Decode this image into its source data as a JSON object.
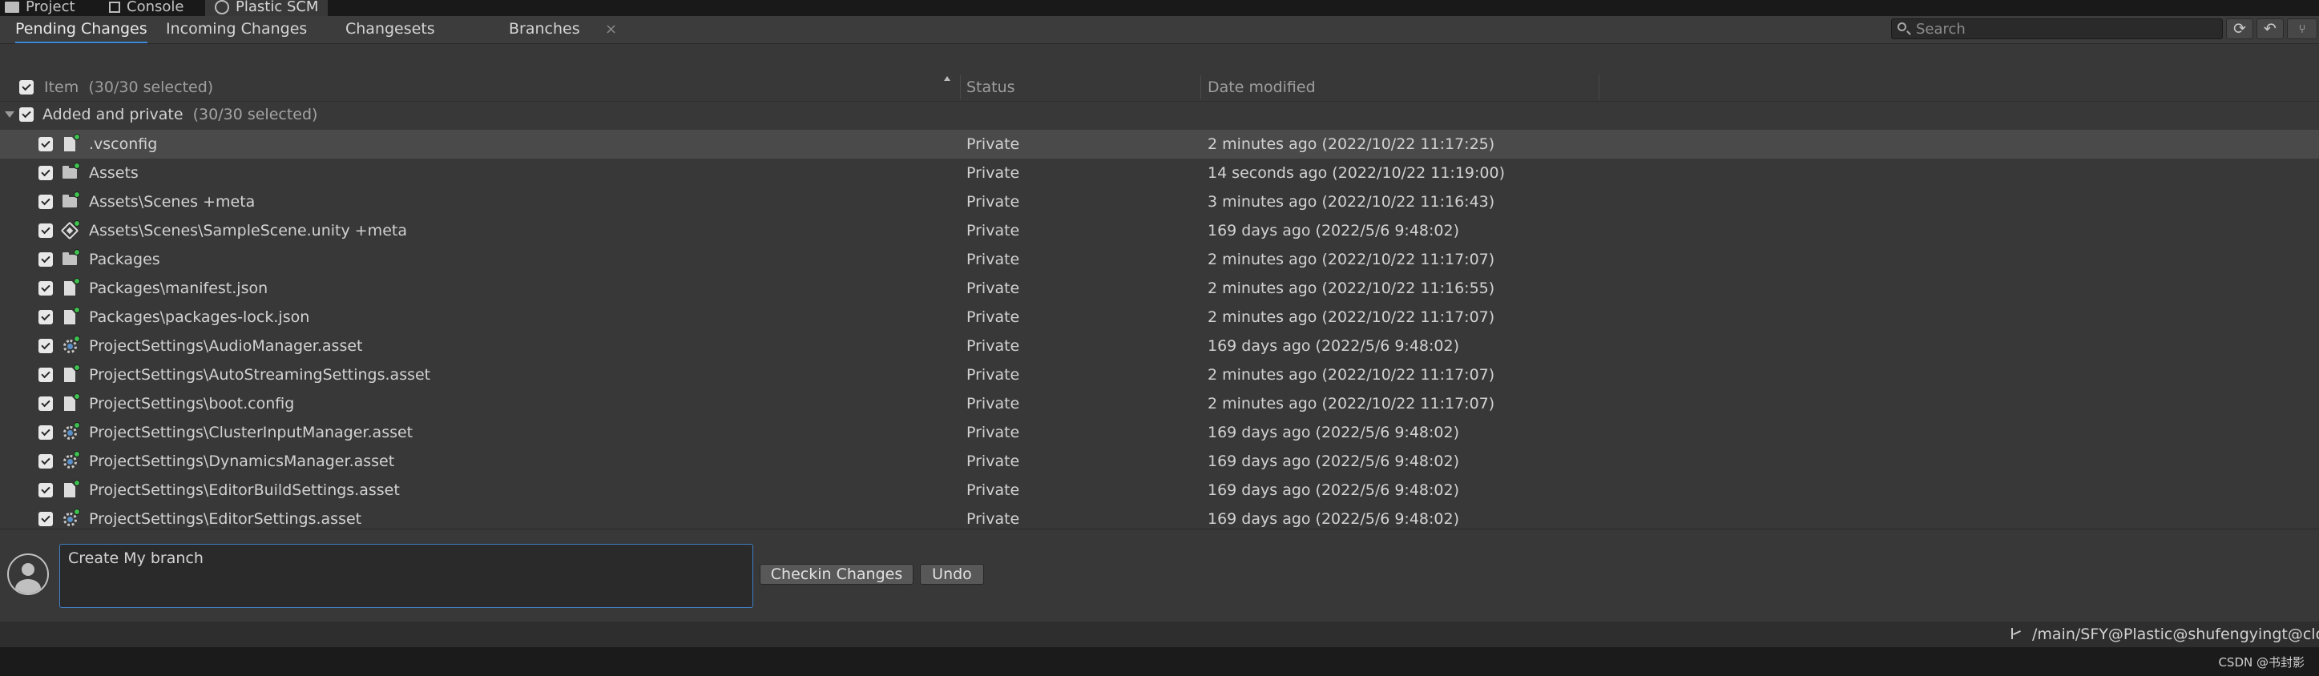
{
  "window_tabs": [
    {
      "label": "Project",
      "icon": "folder-icon"
    },
    {
      "label": "Console",
      "icon": "console-icon"
    },
    {
      "label": "Plastic SCM",
      "icon": "plastic-scm-icon"
    }
  ],
  "sub_tabs": [
    {
      "label": "Pending Changes",
      "active": true
    },
    {
      "label": "Incoming Changes"
    },
    {
      "label": "Changesets"
    },
    {
      "label": "Branches",
      "closable": true
    }
  ],
  "search": {
    "placeholder": "Search",
    "value": ""
  },
  "toolbar_buttons": [
    "refresh-icon",
    "undo-icon",
    "branch-options-icon"
  ],
  "columns": {
    "item": "Item",
    "item_count": "(30/30 selected)",
    "status": "Status",
    "date": "Date modified"
  },
  "group": {
    "label": "Added and private",
    "count": "(30/30 selected)"
  },
  "rows": [
    {
      "name": ".vsconfig",
      "icon": "file-icon",
      "status": "Private",
      "date": "2 minutes ago (2022/10/22 11:17:25)",
      "selected": true
    },
    {
      "name": "Assets",
      "icon": "folder-icon",
      "status": "Private",
      "date": "14 seconds ago (2022/10/22 11:19:00)"
    },
    {
      "name": "Assets\\Scenes +meta",
      "icon": "folder-icon",
      "status": "Private",
      "date": "3 minutes ago (2022/10/22 11:16:43)"
    },
    {
      "name": "Assets\\Scenes\\SampleScene.unity +meta",
      "icon": "unity-scene-icon",
      "status": "Private",
      "date": "169 days ago (2022/5/6 9:48:02)"
    },
    {
      "name": "Packages",
      "icon": "folder-icon",
      "status": "Private",
      "date": "2 minutes ago (2022/10/22 11:17:07)"
    },
    {
      "name": "Packages\\manifest.json",
      "icon": "file-icon",
      "status": "Private",
      "date": "2 minutes ago (2022/10/22 11:16:55)"
    },
    {
      "name": "Packages\\packages-lock.json",
      "icon": "file-icon",
      "status": "Private",
      "date": "2 minutes ago (2022/10/22 11:17:07)"
    },
    {
      "name": "ProjectSettings\\AudioManager.asset",
      "icon": "settings-asset-icon",
      "status": "Private",
      "date": "169 days ago (2022/5/6 9:48:02)"
    },
    {
      "name": "ProjectSettings\\AutoStreamingSettings.asset",
      "icon": "file-icon",
      "status": "Private",
      "date": "2 minutes ago (2022/10/22 11:17:07)"
    },
    {
      "name": "ProjectSettings\\boot.config",
      "icon": "file-icon",
      "status": "Private",
      "date": "2 minutes ago (2022/10/22 11:17:07)"
    },
    {
      "name": "ProjectSettings\\ClusterInputManager.asset",
      "icon": "settings-asset-icon",
      "status": "Private",
      "date": "169 days ago (2022/5/6 9:48:02)"
    },
    {
      "name": "ProjectSettings\\DynamicsManager.asset",
      "icon": "settings-asset-icon",
      "status": "Private",
      "date": "169 days ago (2022/5/6 9:48:02)"
    },
    {
      "name": "ProjectSettings\\EditorBuildSettings.asset",
      "icon": "file-icon",
      "status": "Private",
      "date": "169 days ago (2022/5/6 9:48:02)"
    },
    {
      "name": "ProjectSettings\\EditorSettings.asset",
      "icon": "settings-asset-icon",
      "status": "Private",
      "date": "169 days ago (2022/5/6 9:48:02)"
    }
  ],
  "checkin": {
    "comment": "Create My branch",
    "checkin_label": "Checkin Changes",
    "undo_label": "Undo"
  },
  "status_bar": {
    "branch": "/main/SFY@Plastic@shufengyingt@cloud"
  },
  "watermark": "CSDN @书封影",
  "colors": {
    "accent": "#3f8ad8",
    "added_badge": "#3fbf4f",
    "background": "#383838"
  }
}
